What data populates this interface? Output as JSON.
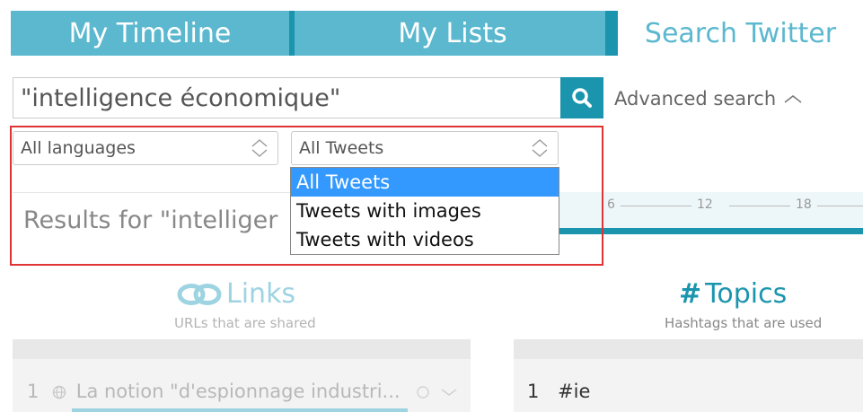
{
  "tabs": [
    {
      "label": "My Timeline"
    },
    {
      "label": "My Lists"
    },
    {
      "label": "Search Twitter"
    }
  ],
  "search": {
    "value": "\"intelligence économique\"",
    "advanced_label": "Advanced search"
  },
  "filters": {
    "language": "All languages",
    "tweet_type": "All Tweets",
    "tweet_type_options": [
      "All Tweets",
      "Tweets with images",
      "Tweets with videos"
    ]
  },
  "results": {
    "label": "Results for \"intelliger",
    "timeline_ticks": [
      "6",
      "12",
      "18"
    ]
  },
  "links_section": {
    "title": "Links",
    "subtitle": "URLs that are shared",
    "rows": [
      {
        "rank": "1",
        "text": "La notion \"d'espionnage industri..."
      }
    ]
  },
  "topics_section": {
    "title": "Topics",
    "subtitle": "Hashtags that are used",
    "rows": [
      {
        "rank": "1",
        "text": "#ie"
      }
    ]
  },
  "colors": {
    "tab_bg": "#5bb8cf",
    "accent": "#1b95ae",
    "highlight": "#e03333",
    "selected_option": "#3399ff"
  }
}
